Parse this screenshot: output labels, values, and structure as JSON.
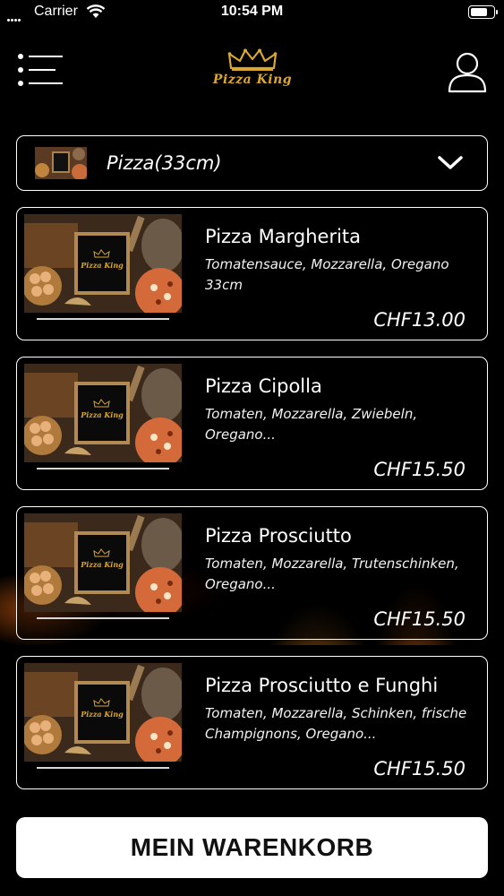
{
  "status_bar": {
    "carrier": "Carrier",
    "time": "10:54 PM",
    "battery_level": 0.75
  },
  "header": {
    "logo_text": "Pizza King",
    "menu_icon": "list-menu-icon",
    "user_icon": "user-profile-icon"
  },
  "category": {
    "label": "Pizza(33cm)",
    "icon": "chevron-down-icon"
  },
  "products": [
    {
      "name": "Pizza Margherita",
      "description": "Tomatensauce, Mozzarella, Oregano 33cm",
      "price": "CHF13.00",
      "image_logo": "Pizza King"
    },
    {
      "name": "Pizza Cipolla",
      "description": "Tomaten, Mozzarella, Zwiebeln, Oregano...",
      "price": "CHF15.50",
      "image_logo": "Pizza King"
    },
    {
      "name": "Pizza Prosciutto",
      "description": "Tomaten, Mozzarella, Trutenschinken, Oregano...",
      "price": "CHF15.50",
      "image_logo": "Pizza King"
    },
    {
      "name": "Pizza Prosciutto e Funghi",
      "description": "Tomaten, Mozzarella, Schinken, frische Champignons, Oregano...",
      "price": "CHF15.50",
      "image_logo": "Pizza King"
    }
  ],
  "cart": {
    "label": "MEIN WARENKORB"
  },
  "colors": {
    "accent_gold": "#d9a732",
    "background": "#000000",
    "button_bg": "#ffffff"
  }
}
